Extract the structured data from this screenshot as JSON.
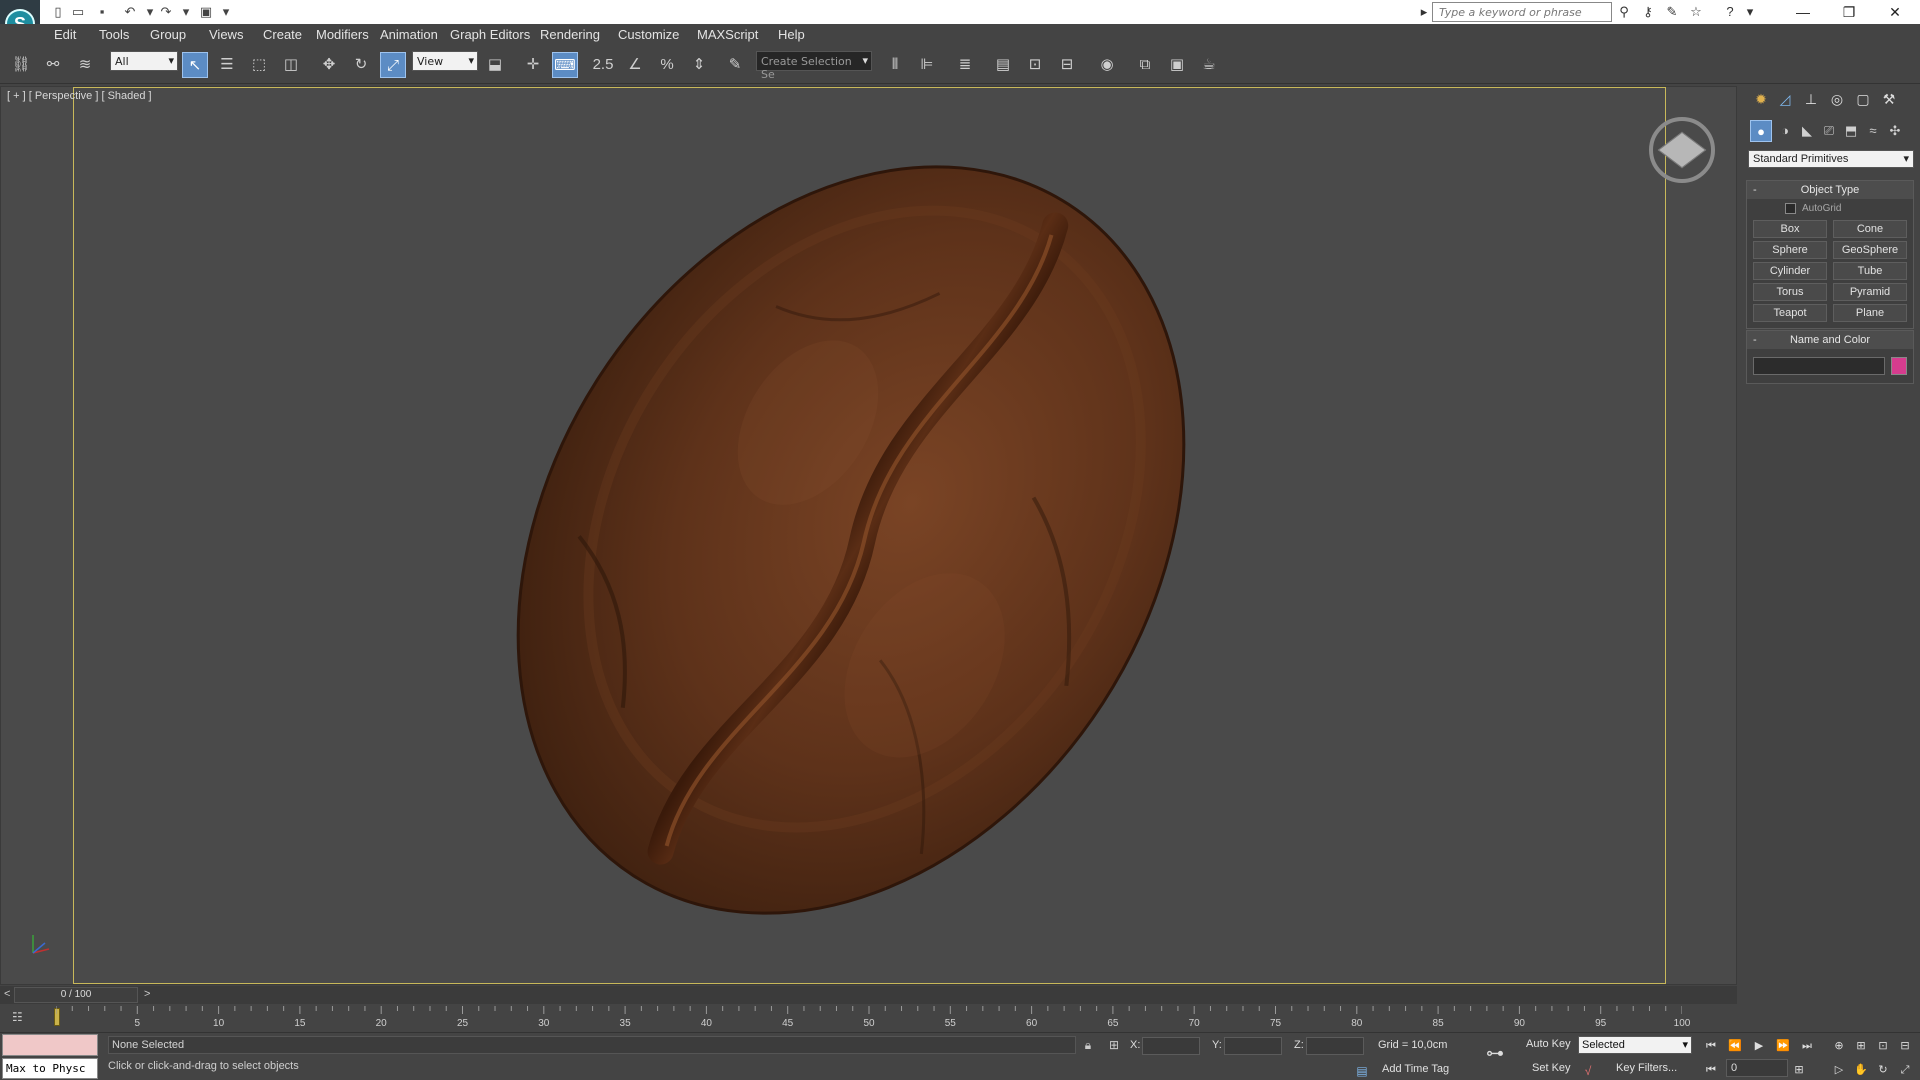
{
  "titlebar": {
    "logo_glyph": "S",
    "search_placeholder": "Type a keyword or phrase",
    "quick_access_icons": [
      "new-file-icon",
      "open-folder-icon",
      "save-icon",
      "undo-icon",
      "redo-icon",
      "project-icon"
    ],
    "window_controls": {
      "minimize": "—",
      "maximize": "❐",
      "close": "✕"
    }
  },
  "menus": [
    "Edit",
    "Tools",
    "Group",
    "Views",
    "Create",
    "Modifiers",
    "Animation",
    "Graph Editors",
    "Rendering",
    "Customize",
    "MAXScript",
    "Help"
  ],
  "toolbar": {
    "selection_filter": "All",
    "reference_coord": "View",
    "snap_label": "2.5",
    "named_selection_placeholder": "Create Selection Se"
  },
  "viewport": {
    "label": "[ + ] [ Perspective ] [ Shaded ]",
    "model": "coffee bean"
  },
  "command_panel": {
    "category": "Standard Primitives",
    "object_type_title": "Object Type",
    "autogrid_label": "AutoGrid",
    "primitives": [
      "Box",
      "Cone",
      "Sphere",
      "GeoSphere",
      "Cylinder",
      "Tube",
      "Torus",
      "Pyramid",
      "Teapot",
      "Plane"
    ],
    "name_color_title": "Name and Color",
    "object_color": "#d63c8e"
  },
  "time_slider": {
    "frame_display": "0 / 100",
    "prev": "<",
    "next": ">"
  },
  "track_bar": {
    "ticks": [
      "5",
      "10",
      "15",
      "20",
      "25",
      "30",
      "35",
      "40",
      "45",
      "50",
      "55",
      "60",
      "65",
      "70",
      "75",
      "80",
      "85",
      "90",
      "95",
      "100"
    ]
  },
  "status": {
    "listener_line": "Max to Physc",
    "selection": "None Selected",
    "prompt": "Click or click-and-drag to select objects",
    "x_label": "X:",
    "y_label": "Y:",
    "z_label": "Z:",
    "grid": "Grid = 10,0cm",
    "add_time_tag": "Add Time Tag",
    "auto_key": "Auto Key",
    "set_key": "Set Key",
    "key_mode": "Selected",
    "key_filters": "Key Filters...",
    "current_frame": "0"
  },
  "colors": {
    "ui_background": "#444444",
    "viewport_background": "#4a4a4a",
    "safe_frame": "#c8b85a",
    "active_tool": "#5c8cc4",
    "bean_base": "#6b3a1e"
  }
}
